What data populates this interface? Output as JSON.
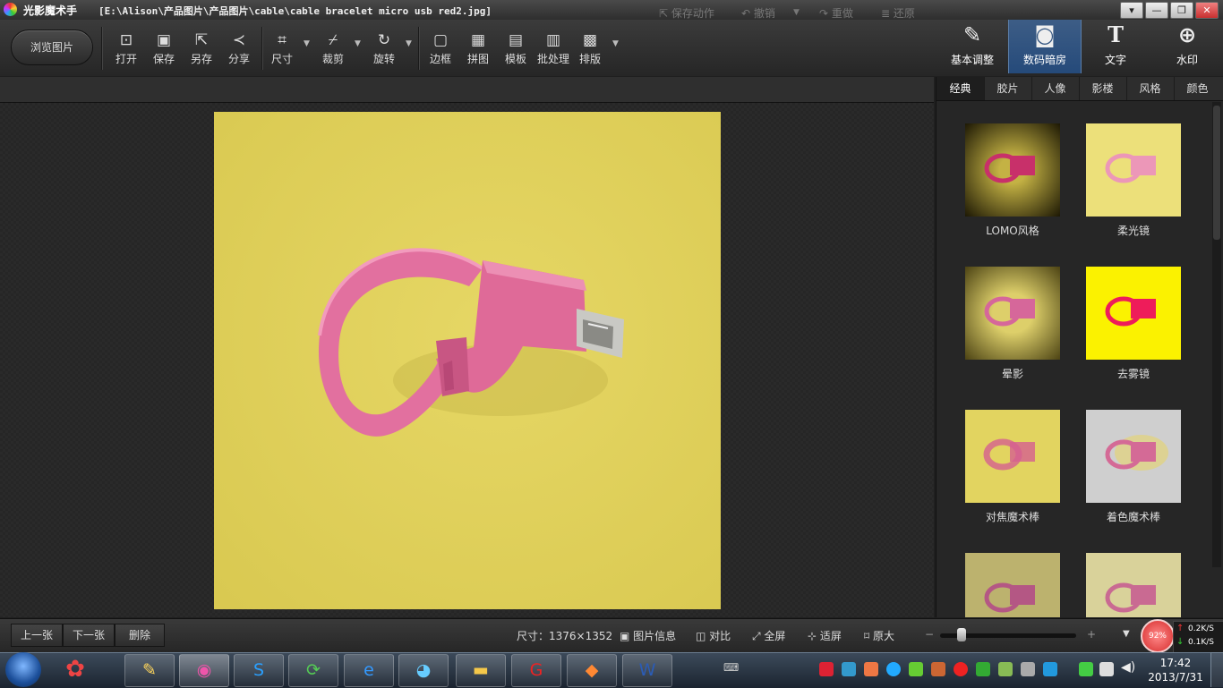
{
  "titlebar": {
    "app_name": "光影魔术手",
    "file_path": "[E:\\Alison\\产品图片\\产品图片\\cable\\cable bracelet micro usb red2.jpg]",
    "controls": [
      "▾",
      "—",
      "❐",
      "✕"
    ]
  },
  "toolbar": {
    "browse": "浏览图片",
    "tools": [
      {
        "label": "打开",
        "icon": "open-icon",
        "glyph": "⊡"
      },
      {
        "label": "保存",
        "icon": "save-icon",
        "glyph": "▣"
      },
      {
        "label": "另存",
        "icon": "save-as-icon",
        "glyph": "⇱"
      },
      {
        "label": "分享",
        "icon": "share-icon",
        "glyph": "≺"
      },
      {
        "label": "尺寸",
        "icon": "resize-icon",
        "glyph": "⌗"
      },
      {
        "label": "裁剪",
        "icon": "crop-icon",
        "glyph": "⌿"
      },
      {
        "label": "旋转",
        "icon": "rotate-icon",
        "glyph": "↻"
      },
      {
        "label": "边框",
        "icon": "border-icon",
        "glyph": "▢"
      },
      {
        "label": "拼图",
        "icon": "collage-icon",
        "glyph": "▦"
      },
      {
        "label": "模板",
        "icon": "template-icon",
        "glyph": "▤"
      },
      {
        "label": "批处理",
        "icon": "batch-icon",
        "glyph": "▥"
      },
      {
        "label": "排版",
        "icon": "layout-icon",
        "glyph": "▩"
      }
    ]
  },
  "modules": [
    {
      "label": "基本调整",
      "icon": "adjust-icon",
      "glyph": "✎"
    },
    {
      "label": "数码暗房",
      "icon": "camera-icon",
      "glyph": "◙"
    },
    {
      "label": "文字",
      "icon": "text-icon",
      "glyph": "T"
    },
    {
      "label": "水印",
      "icon": "watermark-icon",
      "glyph": "⊕"
    }
  ],
  "subbar": {
    "save_action": "保存动作",
    "undo": "撤销",
    "redo": "重做",
    "restore": "还原"
  },
  "filter_tabs": [
    "经典",
    "胶片",
    "人像",
    "影楼",
    "风格",
    "颜色"
  ],
  "filters": [
    {
      "label": "LOMO风格"
    },
    {
      "label": "柔光镜"
    },
    {
      "label": "晕影"
    },
    {
      "label": "去雾镜"
    },
    {
      "label": "对焦魔术棒"
    },
    {
      "label": "着色魔术棒"
    },
    {
      "label": ""
    },
    {
      "label": ""
    }
  ],
  "bottombar": {
    "prev": "上一张",
    "next": "下一张",
    "delete": "删除",
    "size": "尺寸：1376×1352",
    "info": "图片信息",
    "compare": "对比",
    "fullscreen": "全屏",
    "fit": "适屏",
    "original": "原大",
    "zoom_minus": "−",
    "zoom_plus": "+",
    "memory_pct": "92%",
    "upload": "0.2K/S",
    "download": "0.1K/S"
  },
  "taskbar": {
    "time": "17:42",
    "date": "2013/7/31"
  },
  "colors": {
    "photo_bg": "#e4d35c",
    "bracelet": "#e2709f",
    "accent": "#2d5b8f"
  }
}
